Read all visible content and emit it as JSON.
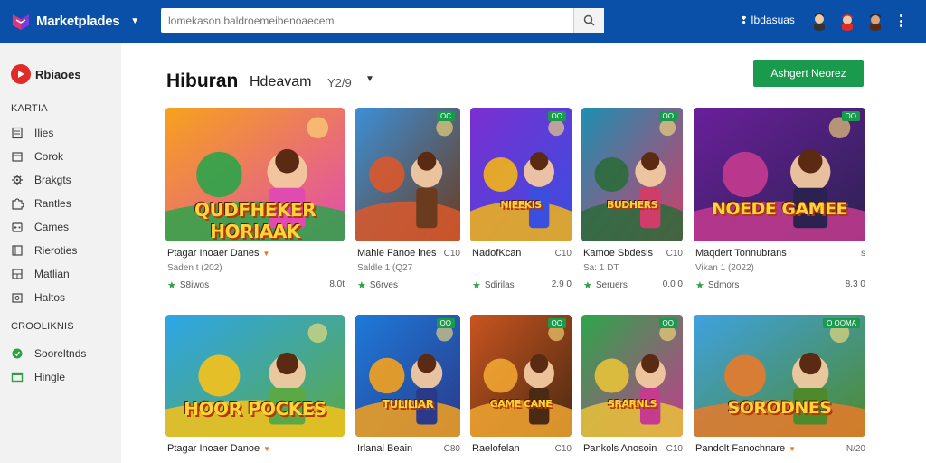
{
  "header": {
    "brand": "Marketplades",
    "search_placeholder": "lomekason baldroemeibenoaecem",
    "account_label": "Ibdasuas",
    "icons": [
      "brand-logo-icon",
      "chevron-down-icon",
      "search-icon",
      "pin-icon",
      "kebab-menu-icon"
    ]
  },
  "sidebar": {
    "header_label": "Rbiaoes",
    "section1": "KARTIA",
    "items1": [
      {
        "label": "Ilies",
        "icon": "document-icon"
      },
      {
        "label": "Corok",
        "icon": "box-icon"
      },
      {
        "label": "Brakgts",
        "icon": "gear-icon"
      },
      {
        "label": "Rantles",
        "icon": "puzzle-icon"
      },
      {
        "label": "Cames",
        "icon": "gamepad-icon"
      },
      {
        "label": "Rieroties",
        "icon": "list-icon"
      },
      {
        "label": "Matlian",
        "icon": "grid-icon"
      },
      {
        "label": "Haltos",
        "icon": "image-icon"
      }
    ],
    "section2": "CROOLIKNIS",
    "items2": [
      {
        "label": "Sooreltnds",
        "icon": "circle-check-icon",
        "color": "#2e9f45"
      },
      {
        "label": "Hingle",
        "icon": "window-icon",
        "color": "#2e9f45"
      }
    ]
  },
  "main": {
    "title": "Hiburan",
    "subtitle": "Hdeavam",
    "count": "Y2/9",
    "cta_label": "Ashgert Neorez"
  },
  "cards": [
    {
      "title": "Ptagar Inoaer Danes",
      "aux": "",
      "caret": true,
      "year": "Saden t (202)",
      "rating": "S8iwos",
      "price": "8.0t",
      "badge": "",
      "overlay": "QUDFHEKER HORIAAK",
      "palette": [
        "#f6a21c",
        "#2ba44a",
        "#e04bb0"
      ]
    },
    {
      "title": "Mahle Fanoe lnes",
      "aux": "C10",
      "caret": false,
      "year": "Saldle 1 (Q27",
      "rating": "S6rves",
      "price": "",
      "badge": "OC",
      "overlay": "",
      "palette": [
        "#3c8fd6",
        "#d9582b",
        "#6b3b1d"
      ]
    },
    {
      "title": "NadofKcan",
      "aux": "C10",
      "caret": false,
      "year": "",
      "rating": "Sdirilas",
      "price": "2.9 0",
      "badge": "OO",
      "overlay": "NIEEKIS",
      "palette": [
        "#7a2fd0",
        "#f2b419",
        "#3a4ee0"
      ]
    },
    {
      "title": "Kamoe Sbdesis",
      "aux": "C10",
      "caret": false,
      "year": "Sa: 1 DT",
      "rating": "Seruers",
      "price": "0.0 0",
      "badge": "OO",
      "overlay": "BUDHERS",
      "palette": [
        "#1d8fb0",
        "#2c6b3a",
        "#d13d6a"
      ]
    },
    {
      "title": "Maqdert Tonnubrans",
      "aux": "s",
      "caret": false,
      "year": "Vikan 1 (2022)",
      "rating": "Sdmors",
      "price": "8.3 0",
      "badge": "OO",
      "overlay": "NOEDE GAMEE",
      "palette": [
        "#6a1f9a",
        "#c43b8f",
        "#2b2252"
      ]
    },
    {
      "title": "Ptagar Inoaer Danoe",
      "aux": "",
      "caret": true,
      "year": "",
      "rating": "",
      "price": "",
      "badge": "",
      "overlay": "HOOR POCKES",
      "palette": [
        "#2ea6e8",
        "#f6c21b",
        "#5aa846"
      ]
    },
    {
      "title": "Irlanal Beain",
      "aux": "C80",
      "caret": false,
      "year": "",
      "rating": "",
      "price": "",
      "badge": "OO",
      "overlay": "TULILIAR",
      "palette": [
        "#1e7ad9",
        "#f4a11e",
        "#2a3a8a"
      ]
    },
    {
      "title": "Raelofelan",
      "aux": "C10",
      "caret": false,
      "year": "",
      "rating": "",
      "price": "",
      "badge": "OO",
      "overlay": "GAME CANE",
      "palette": [
        "#c9541f",
        "#f0a431",
        "#4a2a12"
      ]
    },
    {
      "title": "Pankols Anosoin",
      "aux": "C10",
      "caret": false,
      "year": "",
      "rating": "",
      "price": "",
      "badge": "OO",
      "overlay": "SRARNLS",
      "palette": [
        "#2da64a",
        "#e7c23a",
        "#c43b8f"
      ]
    },
    {
      "title": "Pandolt Fanochnare",
      "aux": "N/20",
      "caret": true,
      "year": "",
      "rating": "",
      "price": "",
      "badge": "O OOMA",
      "overlay": "SORODNES",
      "palette": [
        "#3fa1e0",
        "#e87a2a",
        "#4e8a2c"
      ]
    }
  ]
}
